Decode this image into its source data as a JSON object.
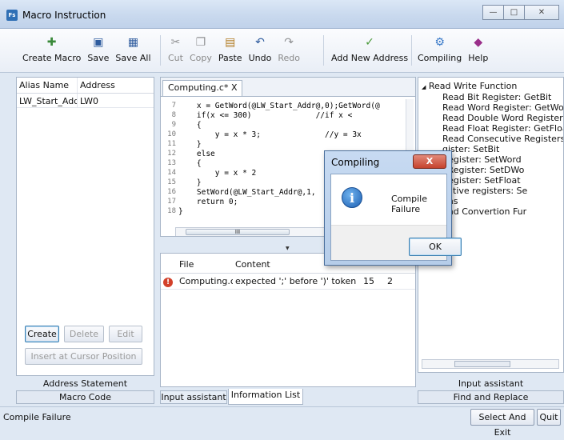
{
  "window": {
    "title": "Macro Instruction",
    "app_icon": "Fs"
  },
  "toolbar": {
    "create_macro": "Create Macro",
    "save": "Save",
    "save_all": "Save All",
    "cut": "Cut",
    "copy": "Copy",
    "paste": "Paste",
    "undo": "Undo",
    "redo": "Redo",
    "add_new_address": "Add New Address",
    "compiling": "Compiling",
    "help": "Help"
  },
  "address_table": {
    "headers": [
      "Alias Name",
      "Address"
    ],
    "rows": [
      [
        "LW_Start_Addr",
        "LW0"
      ]
    ]
  },
  "left_buttons": {
    "create": "Create",
    "delete": "Delete",
    "edit": "Edit",
    "insert_at_cursor": "Insert at Cursor Position"
  },
  "left_labels": {
    "address_statement": "Address Statement",
    "macro_code": "Macro Code"
  },
  "editor": {
    "tab": "Computing.c* X",
    "lines": [
      {
        "n": "7",
        "code": "    x = GetWord(@LW_Start_Addr@,0);GetWord(@"
      },
      {
        "n": "8",
        "code": "    if(x <= 300)              //if x <"
      },
      {
        "n": "9",
        "code": "    {"
      },
      {
        "n": "10",
        "code": "        y = x * 3;              //y = 3x"
      },
      {
        "n": "11",
        "code": "    }"
      },
      {
        "n": "12",
        "code": "    else"
      },
      {
        "n": "13",
        "code": "    {"
      },
      {
        "n": "14",
        "code": "        y = x * 2"
      },
      {
        "n": "15",
        "code": "    }"
      },
      {
        "n": "16",
        "code": "    SetWord(@LW_Start_Addr@,1,"
      },
      {
        "n": "17",
        "code": "    return 0;"
      },
      {
        "n": "18",
        "code": "}"
      }
    ],
    "scroll_thumb": "III"
  },
  "info_list": {
    "headers": [
      "File",
      "Content"
    ],
    "rows": [
      {
        "file": "Computing.c",
        "content": "expected ';' before ')' token",
        "line": "15",
        "col": "2"
      }
    ]
  },
  "center_tabs": {
    "input_assistant": "Input assistant",
    "information_list": "Information List"
  },
  "tree": {
    "root": "Read Write Function",
    "items": [
      "Read Bit Register: GetBit",
      "Read Word Register: GetWo",
      "Read Double Word Register",
      "Read Float Register: GetFloa",
      "Read Consecutive Registers:",
      "gister: SetBit",
      "Register: SetWord",
      "l Register: SetDWo",
      "Register: SetFloat",
      "cutive registers: Se",
      "ons",
      "and Convertion Fur"
    ]
  },
  "right_labels": {
    "input_assistant": "Input assistant",
    "find_and_replace": "Find and Replace"
  },
  "dialog": {
    "title": "Compiling",
    "close": "X",
    "message": "Compile Failure",
    "ok": "OK",
    "icon": "i"
  },
  "status": {
    "text": "Compile Failure",
    "select_and_exit": "Select And Exit",
    "quit": "Quit"
  }
}
